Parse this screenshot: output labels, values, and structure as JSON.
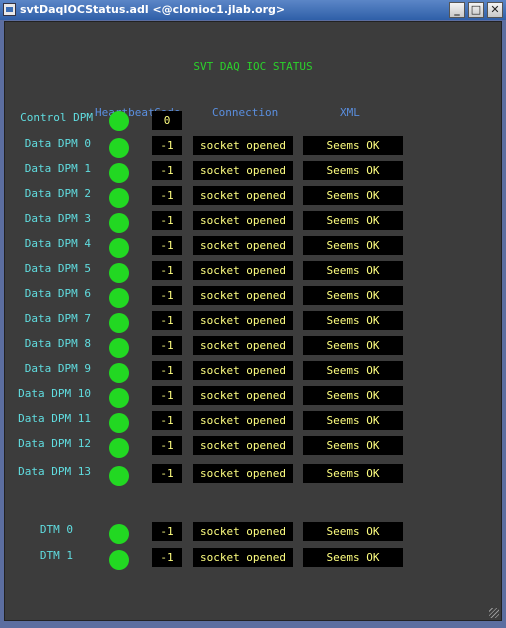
{
  "window": {
    "title": "svtDaqIOCStatus.adl <@clonioc1.jlab.org>"
  },
  "page_title": "SVT DAQ IOC STATUS",
  "headers": {
    "heartbeat": "Heartbeat",
    "code": "Code",
    "connection": "Connection",
    "xml": "XML"
  },
  "control": {
    "label": "Control DPM",
    "code": "0"
  },
  "dpms": [
    {
      "label": "Data DPM 0",
      "code": "-1",
      "connection": "socket opened",
      "xml": "Seems OK"
    },
    {
      "label": "Data DPM 1",
      "code": "-1",
      "connection": "socket opened",
      "xml": "Seems OK"
    },
    {
      "label": "Data DPM 2",
      "code": "-1",
      "connection": "socket opened",
      "xml": "Seems OK"
    },
    {
      "label": "Data DPM 3",
      "code": "-1",
      "connection": "socket opened",
      "xml": "Seems OK"
    },
    {
      "label": "Data DPM 4",
      "code": "-1",
      "connection": "socket opened",
      "xml": "Seems OK"
    },
    {
      "label": "Data DPM 5",
      "code": "-1",
      "connection": "socket opened",
      "xml": "Seems OK"
    },
    {
      "label": "Data DPM 6",
      "code": "-1",
      "connection": "socket opened",
      "xml": "Seems OK"
    },
    {
      "label": "Data DPM 7",
      "code": "-1",
      "connection": "socket opened",
      "xml": "Seems OK"
    },
    {
      "label": "Data DPM 8",
      "code": "-1",
      "connection": "socket opened",
      "xml": "Seems OK"
    },
    {
      "label": "Data DPM 9",
      "code": "-1",
      "connection": "socket opened",
      "xml": "Seems OK"
    },
    {
      "label": "Data DPM 10",
      "code": "-1",
      "connection": "socket opened",
      "xml": "Seems OK"
    },
    {
      "label": "Data DPM 11",
      "code": "-1",
      "connection": "socket opened",
      "xml": "Seems OK"
    },
    {
      "label": "Data DPM 12",
      "code": "-1",
      "connection": "socket opened",
      "xml": "Seems OK"
    },
    {
      "label": "Data DPM 13",
      "code": "-1",
      "connection": "socket opened",
      "xml": "Seems OK"
    }
  ],
  "dtms": [
    {
      "label": "DTM 0",
      "code": "-1",
      "connection": "socket opened",
      "xml": "Seems OK"
    },
    {
      "label": "DTM 1",
      "code": "-1",
      "connection": "socket opened",
      "xml": "Seems OK"
    }
  ],
  "colors": {
    "led_ok": "#22d822",
    "label": "#60dde0",
    "header": "#5a8fe0",
    "value": "#ffff80",
    "title": "#2bd22b"
  }
}
